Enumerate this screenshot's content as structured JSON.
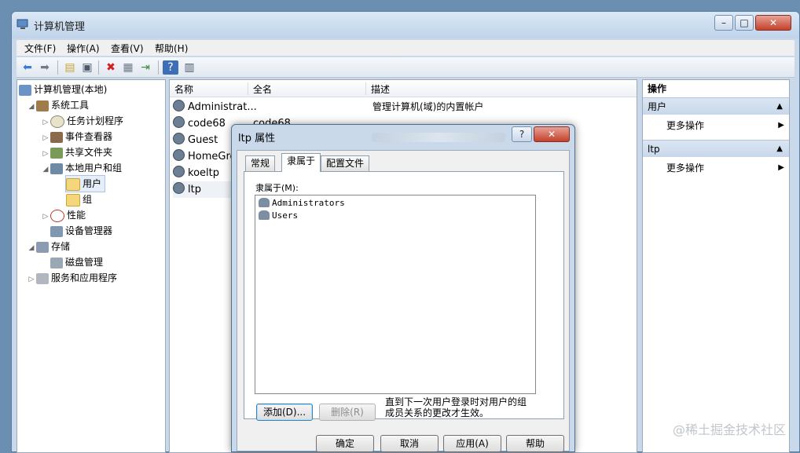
{
  "window": {
    "title": "计算机管理",
    "caption_buttons": [
      "minimize-icon",
      "maximize-icon",
      "close-icon"
    ]
  },
  "menu": [
    "文件(F)",
    "操作(A)",
    "查看(V)",
    "帮助(H)"
  ],
  "toolbar_icons": [
    "back-icon",
    "forward-icon",
    "up-folder-icon",
    "show-tree-icon",
    "delete-icon",
    "properties-icon",
    "export-icon",
    "help-icon",
    "show-action-pane-icon"
  ],
  "tree": {
    "root": "计算机管理(本地)",
    "system_tools": "系统工具",
    "task_scheduler": "任务计划程序",
    "event_viewer": "事件查看器",
    "shared_folders": "共享文件夹",
    "local_users_groups": "本地用户和组",
    "users": "用户",
    "groups": "组",
    "performance": "性能",
    "device_manager": "设备管理器",
    "storage": "存储",
    "disk_management": "磁盘管理",
    "services_apps": "服务和应用程序"
  },
  "list": {
    "columns": [
      "名称",
      "全名",
      "描述"
    ],
    "rows": [
      {
        "name": "Administrat...",
        "fullname": "",
        "desc": "管理计算机(域)的内置帐户"
      },
      {
        "name": "code68",
        "fullname": "code68",
        "desc": ""
      },
      {
        "name": "Guest",
        "fullname": "",
        "desc": ""
      },
      {
        "name": "HomeGro",
        "fullname": "",
        "desc": ""
      },
      {
        "name": "koeltp",
        "fullname": "",
        "desc": ""
      },
      {
        "name": "ltp",
        "fullname": "",
        "desc": ""
      }
    ]
  },
  "actions": {
    "header": "操作",
    "groups": [
      {
        "title": "用户",
        "item": "更多操作"
      },
      {
        "title": "ltp",
        "item": "更多操作"
      }
    ]
  },
  "dialog": {
    "title": "ltp 属性",
    "help": "?",
    "tabs": [
      "常规",
      "隶属于",
      "配置文件"
    ],
    "member_label": "隶属于(M):",
    "members": [
      "Administrators",
      "Users"
    ],
    "add_button": "添加(D)...",
    "remove_button": "删除(R)",
    "note": "直到下一次用户登录时对用户的组成员关系的更改才生效。",
    "ok": "确定",
    "cancel": "取消",
    "apply": "应用(A)",
    "help_button": "帮助"
  },
  "watermark": "@稀土掘金技术社区",
  "colors": {
    "title_bar": "#c9d9ea",
    "close_button": "#c4412b",
    "selection": "#e5eef9"
  }
}
